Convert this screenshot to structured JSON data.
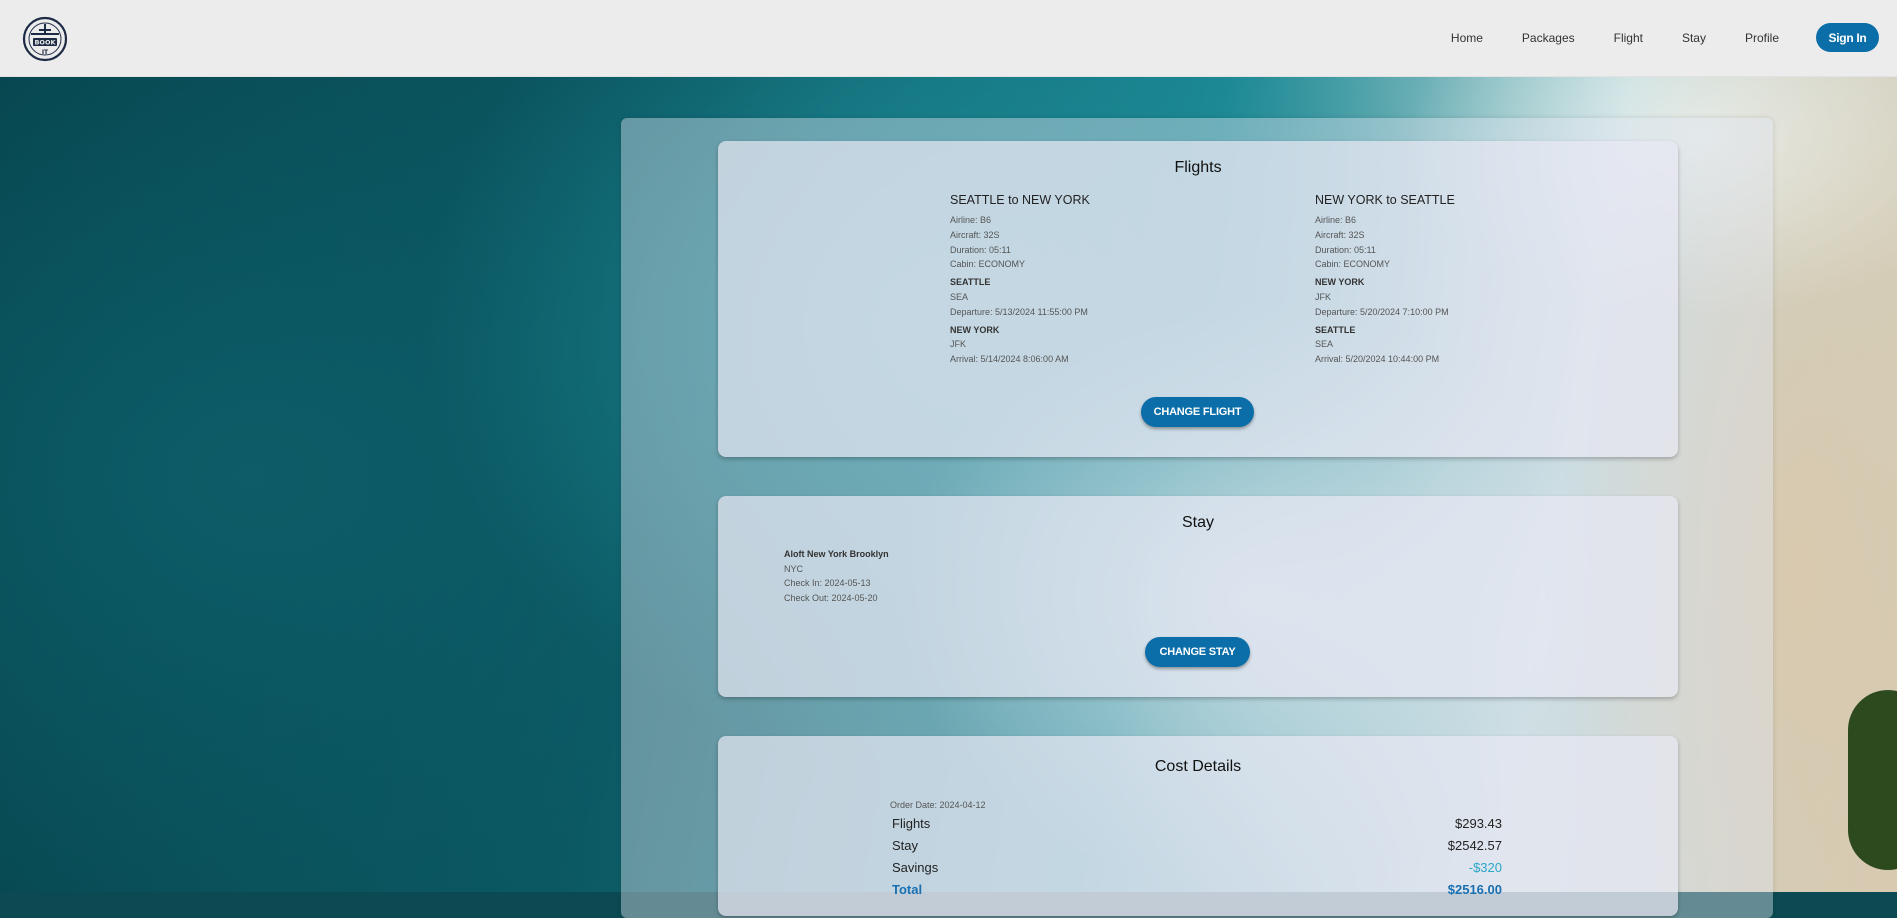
{
  "nav": {
    "items": [
      "Home",
      "Packages",
      "Flight",
      "Stay",
      "Profile"
    ],
    "signin_label": "Sign In",
    "logo_text": "BOOK IT"
  },
  "flights": {
    "title": "Flights",
    "outbound": {
      "heading": "SEATTLE to NEW YORK",
      "airline": "Airline: B6",
      "aircraft": "Aircraft: 32S",
      "duration": "Duration: 05:11",
      "cabin": "Cabin: ECONOMY",
      "from_city": "SEATTLE",
      "from_code": "SEA",
      "departure": "Departure: 5/13/2024 11:55:00 PM",
      "to_city": "NEW YORK",
      "to_code": "JFK",
      "arrival": "Arrival: 5/14/2024 8:06:00 AM"
    },
    "return": {
      "heading": "NEW YORK to SEATTLE",
      "airline": "Airline: B6",
      "aircraft": "Aircraft: 32S",
      "duration": "Duration: 05:11",
      "cabin": "Cabin: ECONOMY",
      "from_city": "NEW YORK",
      "from_code": "JFK",
      "departure": "Departure: 5/20/2024 7:10:00 PM",
      "to_city": "SEATTLE",
      "to_code": "SEA",
      "arrival": "Arrival: 5/20/2024 10:44:00 PM"
    },
    "change_label": "CHANGE FLIGHT"
  },
  "stay": {
    "title": "Stay",
    "hotel": "Aloft New York Brooklyn",
    "city": "NYC",
    "check_in": "Check In: 2024-05-13",
    "check_out": "Check Out: 2024-05-20",
    "change_label": "CHANGE STAY"
  },
  "cost": {
    "title": "Cost Details",
    "order_date": "Order Date: 2024-04-12",
    "rows": [
      {
        "label": "Flights",
        "value": "$293.43"
      },
      {
        "label": "Stay",
        "value": "$2542.57"
      },
      {
        "label": "Savings",
        "value": "-$320"
      },
      {
        "label": "Total",
        "value": "$2516.00"
      }
    ]
  },
  "colors": {
    "accent": "#0b6ea8",
    "savings": "#2aa7c9",
    "total": "#1a6fb0"
  }
}
